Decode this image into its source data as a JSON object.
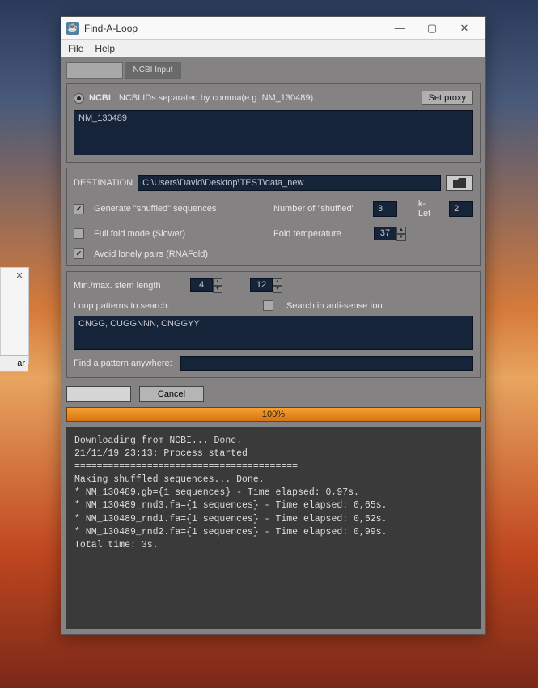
{
  "window": {
    "title": "Find-A-Loop",
    "menu": {
      "file": "File",
      "help": "Help"
    }
  },
  "tabs": {
    "active_label": "NCBI Input"
  },
  "ncbi": {
    "radio_label": "NCBI",
    "hint": "NCBI IDs separated by comma(e.g. NM_130489).",
    "set_proxy": "Set proxy",
    "ids": "NM_130489"
  },
  "dest": {
    "label": "DESTINATION",
    "path": "C:\\Users\\David\\Desktop\\TEST\\data_new"
  },
  "options": {
    "generate_shuffled_label": "Generate \"shuffled\" sequences",
    "generate_shuffled": true,
    "num_shuffled_label": "Number of \"shuffled\"",
    "num_shuffled": "3",
    "klet_label": "k-Let",
    "klet": "2",
    "full_fold_label": "Full fold mode (Slower)",
    "full_fold": false,
    "fold_temp_label": "Fold temperature",
    "fold_temp": "37",
    "avoid_lonely_label": "Avoid lonely pairs (RNAFold)",
    "avoid_lonely": true
  },
  "stem": {
    "label": "Min./max. stem length",
    "min": "4",
    "max": "12"
  },
  "loop": {
    "label": "Loop patterns to search:",
    "antisense_label": "Search in anti-sense too",
    "antisense": false,
    "patterns": "CNGG, CUGGNNN, CNGGYY"
  },
  "pattern": {
    "label": "Find a pattern anywhere:",
    "value": ""
  },
  "actions": {
    "run": "",
    "cancel": "Cancel"
  },
  "progress": {
    "text": "100%"
  },
  "console": "Downloading from NCBI... Done.\n21/11/19 23:13: Process started\n========================================\nMaking shuffled sequences... Done.\n* NM_130489.gb={1 sequences} - Time elapsed: 0,97s.\n* NM_130489_rnd3.fa={1 sequences} - Time elapsed: 0,65s.\n* NM_130489_rnd1.fa={1 sequences} - Time elapsed: 0,52s.\n* NM_130489_rnd2.fa={1 sequences} - Time elapsed: 0,99s.\nTotal time: 3s.",
  "stray": {
    "btn": "ar"
  }
}
